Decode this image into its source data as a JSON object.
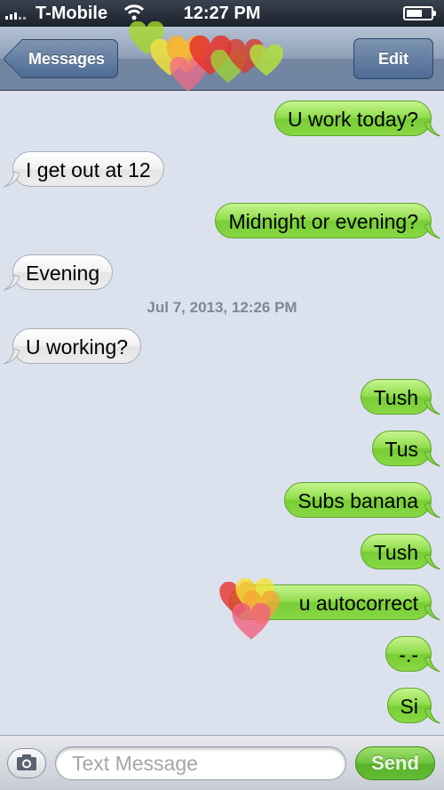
{
  "status_bar": {
    "carrier": "T-Mobile",
    "time": "12:27 PM",
    "battery_level": 0.65,
    "signal_icon": "signal-bars-icon",
    "wifi_icon": "wifi-icon"
  },
  "nav": {
    "back_label": "Messages",
    "edit_label": "Edit"
  },
  "messages": [
    {
      "text": "U work today?",
      "side": "out"
    },
    {
      "text": "I get out at 12",
      "side": "in"
    },
    {
      "text": "Midnight or evening?",
      "side": "out"
    },
    {
      "text": "Evening",
      "side": "in"
    },
    {
      "text": "U working?",
      "side": "in"
    },
    {
      "text": "Tush",
      "side": "out"
    },
    {
      "text": "Tus",
      "side": "out"
    },
    {
      "text": "Subs banana",
      "side": "out"
    },
    {
      "text": "Tush",
      "side": "out"
    },
    {
      "text": "u autocorrect",
      "side": "out"
    },
    {
      "text": "-.-",
      "side": "out"
    },
    {
      "text": "Si",
      "side": "out"
    }
  ],
  "timestamp": "Jul 7, 2013, 12:26 PM",
  "composer": {
    "placeholder": "Text Message",
    "send_label": "Send",
    "camera_icon": "camera-icon"
  },
  "colors": {
    "outgoing_bubble": "#8fdc4a",
    "incoming_bubble": "#f1f1f1",
    "background": "#dbe2ed"
  }
}
